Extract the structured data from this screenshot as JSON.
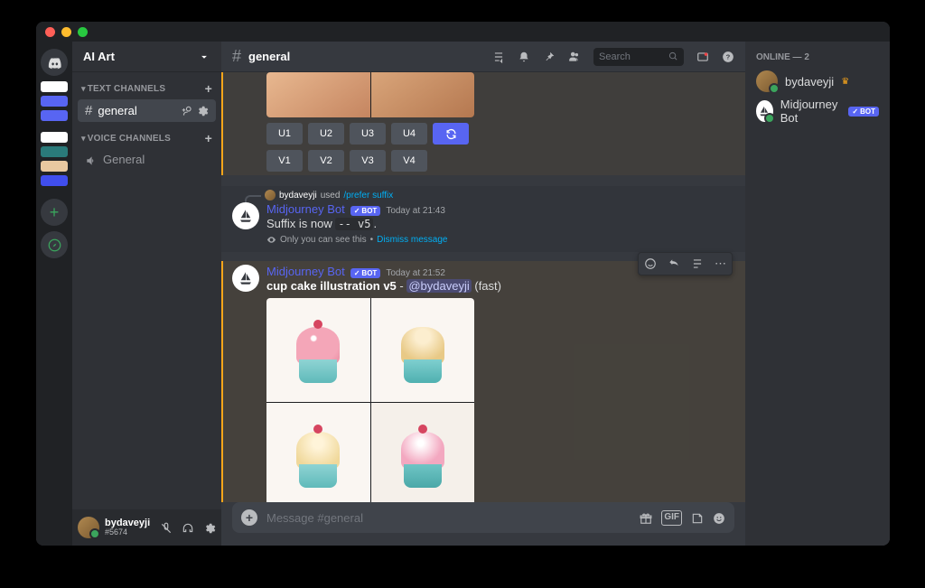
{
  "serverName": "AI Art",
  "channels": {
    "textLabel": "TEXT CHANNELS",
    "voiceLabel": "VOICE CHANNELS",
    "text": [
      {
        "name": "general",
        "active": true
      }
    ],
    "voice": [
      {
        "name": "General"
      }
    ]
  },
  "currentUser": {
    "name": "bydaveyji",
    "tag": "#5674"
  },
  "chatHeader": {
    "channel": "general"
  },
  "search": {
    "placeholder": "Search"
  },
  "composer": {
    "placeholder": "Message #general"
  },
  "members": {
    "header": "ONLINE — 2",
    "list": [
      {
        "name": "bydaveyji",
        "owner": true
      },
      {
        "name": "Midjourney Bot",
        "bot": true,
        "botLabel": "BOT"
      }
    ]
  },
  "buttons": {
    "u": [
      "U1",
      "U2",
      "U3",
      "U4"
    ],
    "v": [
      "V1",
      "V2",
      "V3",
      "V4"
    ]
  },
  "messages": {
    "sysReply": {
      "replyUser": "bydaveyji",
      "replyVerb": "used",
      "replyCmd": "/prefer suffix",
      "author": "Midjourney Bot",
      "botLabel": "BOT",
      "time": "Today at 21:43",
      "textPrefix": "Suffix is now ",
      "textCode": "-- v5",
      "textSuffix": ".",
      "notePrefix": "Only you can see this",
      "noteSep": " • ",
      "noteLink": "Dismiss message"
    },
    "main": {
      "author": "Midjourney Bot",
      "botLabel": "BOT",
      "time": "Today at 21:52",
      "promptBold": "cup cake illustration v5",
      "dash": " - ",
      "mention": "@bydaveyji",
      "mode": " (fast)"
    }
  }
}
